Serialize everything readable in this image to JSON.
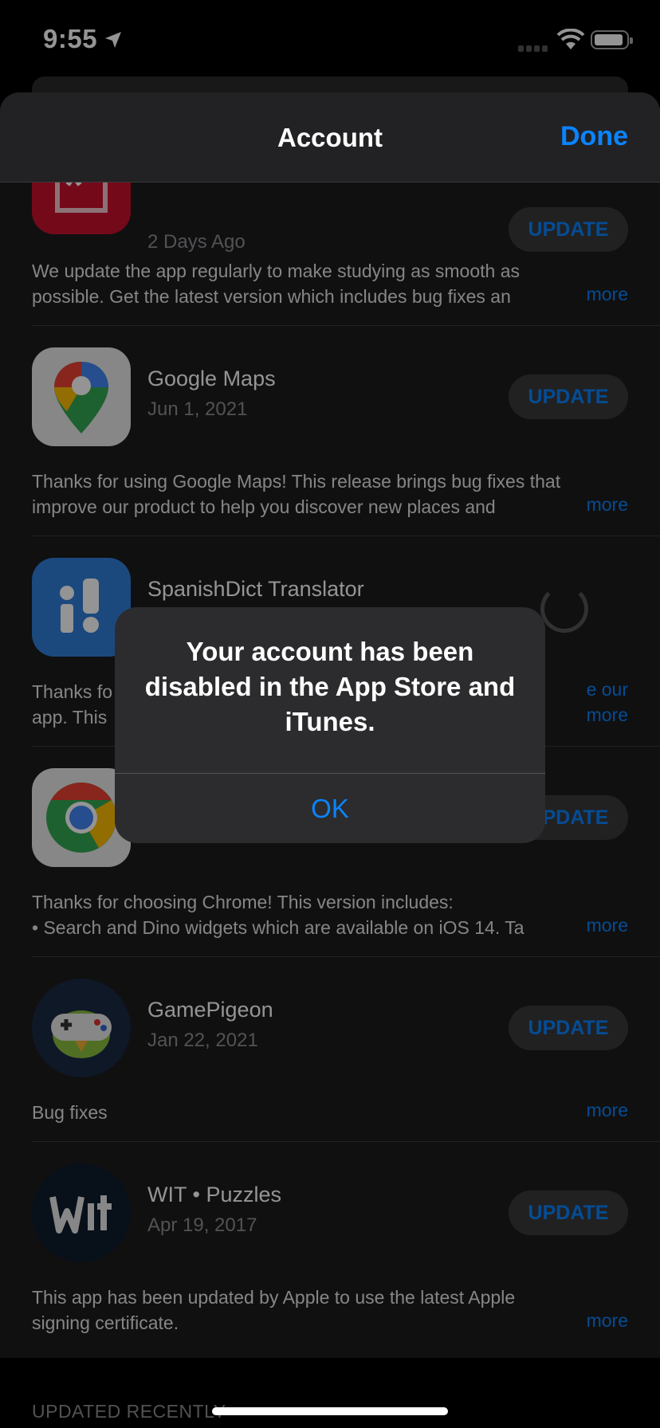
{
  "status_bar": {
    "time": "9:55"
  },
  "nav": {
    "title": "Account",
    "done_label": "Done"
  },
  "apps": [
    {
      "date": "2 Days Ago",
      "button": "UPDATE",
      "notes": [
        "We update the app regularly to make studying as smooth as",
        "possible. Get the latest version which includes bug fixes an"
      ],
      "more": "more"
    },
    {
      "name": "Google Maps",
      "date": "Jun 1, 2021",
      "button": "UPDATE",
      "notes": [
        "Thanks for using Google Maps! This release brings bug fixes that",
        "improve our product to help you discover new places and"
      ],
      "more": "more"
    },
    {
      "name": "SpanishDict Translator",
      "notes": [
        "Thanks fo",
        "app. This"
      ],
      "notes_tail": "e our",
      "more": "more"
    },
    {
      "button": "UPDATE",
      "notes": [
        "Thanks for choosing Chrome! This version includes:",
        "• Search and Dino widgets which are available on iOS 14. Ta"
      ],
      "more": "more"
    },
    {
      "name": "GamePigeon",
      "date": "Jan 22, 2021",
      "button": "UPDATE",
      "notes": [
        "Bug fixes"
      ],
      "more": "more"
    },
    {
      "name": "WIT • Puzzles",
      "date": "Apr 19, 2017",
      "button": "UPDATE",
      "notes": [
        "This app has been updated by Apple to use the latest Apple",
        "signing certificate."
      ],
      "more": "more"
    }
  ],
  "section_header": "UPDATED RECENTLY",
  "alert": {
    "message": "Your account has been disabled in the App Store and iTunes.",
    "ok_label": "OK"
  },
  "colors": {
    "accent": "#0a84ff",
    "sheet_bg": "#1c1c1e",
    "alert_bg": "#2c2c2e"
  }
}
